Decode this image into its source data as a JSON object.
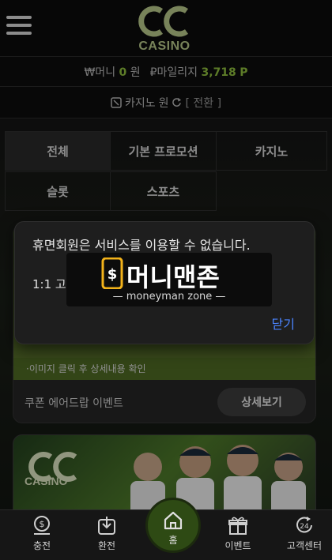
{
  "header": {
    "logo_text": "CASINO",
    "menu_icon": "hamburger-menu-icon"
  },
  "balance": {
    "money_label": "₩머니",
    "money_value": "0",
    "money_unit": "원",
    "mileage_label": "₽마일리지",
    "mileage_value": "3,718",
    "mileage_unit": "P"
  },
  "casino_balance": {
    "label": "카지노",
    "unit": "원",
    "switch_label": "[ 전환 ]"
  },
  "tabs": [
    {
      "label": "전체"
    },
    {
      "label": "기본 프로모션"
    },
    {
      "label": "카지노"
    },
    {
      "label": "슬롯"
    },
    {
      "label": "스포츠"
    }
  ],
  "promo_card": {
    "hint": "·이미지 클릭 후 상세내용 확인",
    "title": "쿠폰 에어드랍 이벤트",
    "detail_button": "상세보기"
  },
  "promo_card2": {
    "logo_text": "CASINO"
  },
  "modal": {
    "message": "휴면회원은 서비스를 이용할 수 없습니다.",
    "sub": "1:1 고",
    "close_label": "닫기"
  },
  "watermark": {
    "main": "머니맨존",
    "sub": "— moneyman zone —"
  },
  "bottom_nav": [
    {
      "label": "충전",
      "icon": "deposit-icon"
    },
    {
      "label": "환전",
      "icon": "withdraw-icon"
    },
    {
      "label": "홈",
      "icon": "home-icon"
    },
    {
      "label": "이벤트",
      "icon": "gift-icon"
    },
    {
      "label": "고객센터",
      "icon": "support-24-icon"
    }
  ],
  "colors": {
    "accent_green": "#8fbf3e",
    "link_blue": "#4b84ff"
  }
}
